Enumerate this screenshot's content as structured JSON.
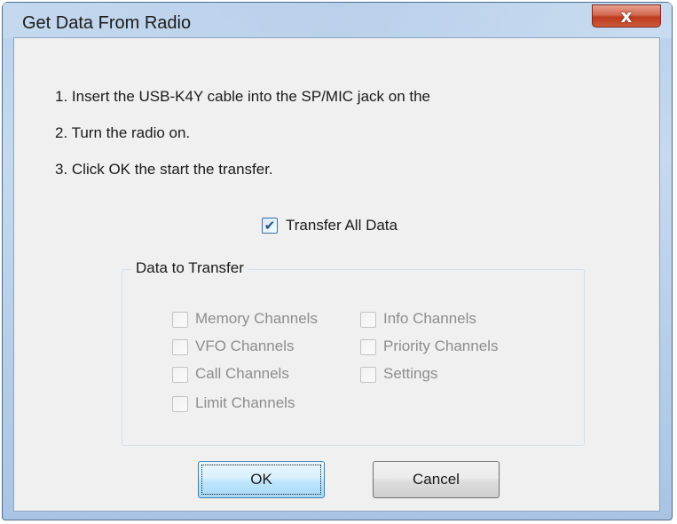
{
  "window": {
    "title": "Get Data From Radio",
    "close_glyph": "x"
  },
  "instructions": [
    "1. Insert the USB-K4Y cable into the SP/MIC jack on the",
    "2. Turn the radio on.",
    "3. Click OK the start the transfer."
  ],
  "transfer_all": {
    "label": "Transfer All Data",
    "checked": true,
    "check_glyph": "✔"
  },
  "group": {
    "title": "Data to Transfer",
    "left_column": [
      "Memory Channels",
      "VFO Channels",
      "Call Channels",
      "Limit Channels"
    ],
    "right_column": [
      "Info Channels",
      "Priority Channels",
      "Settings"
    ],
    "enabled": false
  },
  "buttons": {
    "ok": "OK",
    "cancel": "Cancel"
  },
  "colors": {
    "title_frame": "#b9d1ea",
    "close_button": "#c7442a",
    "disabled_text": "#8d8d8d",
    "default_button_border": "#3c7fb1"
  }
}
